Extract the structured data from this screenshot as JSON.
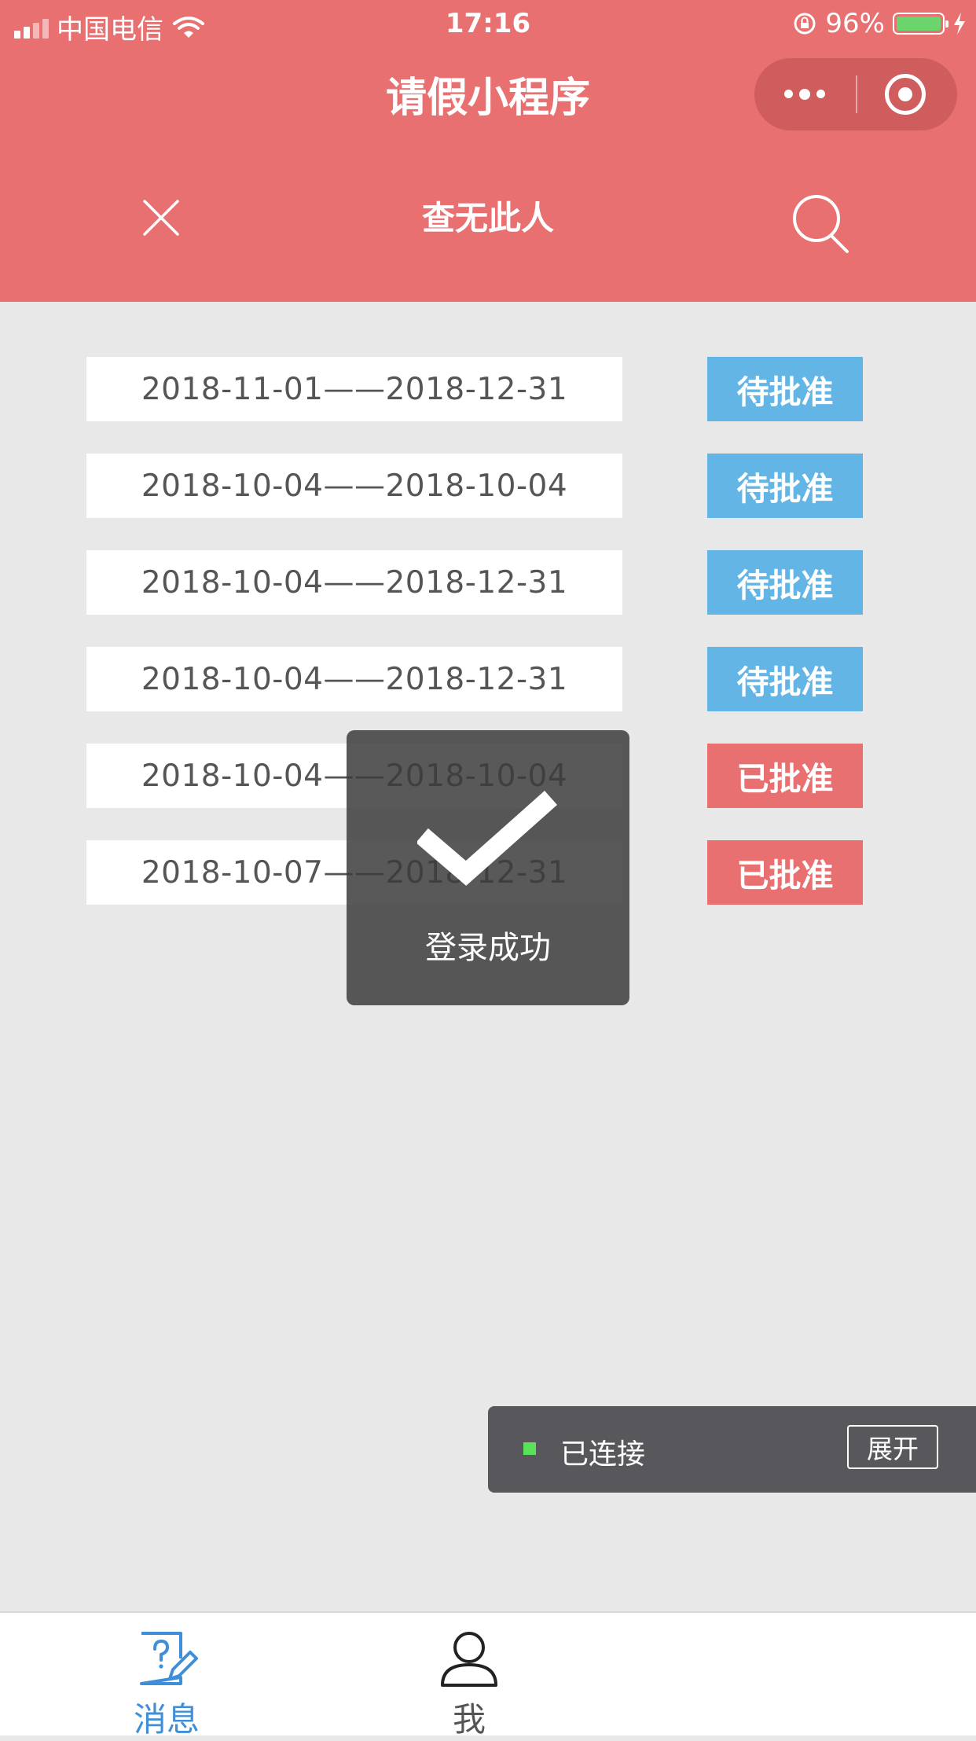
{
  "status_bar": {
    "carrier": "中国电信",
    "time": "17:16",
    "battery": "96%"
  },
  "nav": {
    "title": "请假小程序",
    "capsule_icons": [
      "more-dots-icon",
      "target-icon"
    ]
  },
  "search_bar": {
    "close_icon": "close-icon",
    "query": "查无此人",
    "search_icon": "search-icon"
  },
  "records": [
    {
      "range": "2018-11-01——2018-12-31",
      "status": "待批准",
      "status_type": "pending"
    },
    {
      "range": "2018-10-04——2018-10-04",
      "status": "待批准",
      "status_type": "pending"
    },
    {
      "range": "2018-10-04——2018-12-31",
      "status": "待批准",
      "status_type": "pending"
    },
    {
      "range": "2018-10-04——2018-12-31",
      "status": "待批准",
      "status_type": "pending"
    },
    {
      "range": "2018-10-04——2018-10-04",
      "status": "已批准",
      "status_type": "approved"
    },
    {
      "range": "2018-10-07——2018-12-31",
      "status": "已批准",
      "status_type": "approved"
    }
  ],
  "toast": {
    "icon": "checkmark-icon",
    "text": "登录成功"
  },
  "vconsole": {
    "status": "已连接",
    "button": "展开"
  },
  "tabbar": {
    "tabs": [
      {
        "label": "消息",
        "icon": "message-edit-icon",
        "active": true
      },
      {
        "label": "我",
        "icon": "user-icon",
        "active": false
      }
    ]
  },
  "colors": {
    "header_bg": "#e87070",
    "pending": "#62b5e5",
    "approved": "#e87070",
    "tab_active": "#3f8fd8",
    "tab_inactive": "#555555"
  }
}
